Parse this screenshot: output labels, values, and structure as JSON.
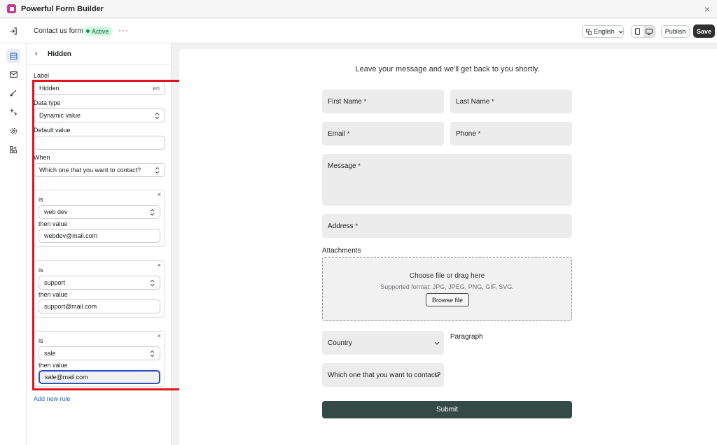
{
  "app": {
    "title": "Powerful Form Builder"
  },
  "topbar": {
    "form_name": "Contact us form",
    "status": "Active",
    "language": "English",
    "publish_label": "Publish",
    "save_label": "Save"
  },
  "panel": {
    "title": "Hidden",
    "label_caption": "Label",
    "label_value": "Hidden",
    "label_lang": "en",
    "data_type_caption": "Data type",
    "data_type_value": "Dynamic value",
    "default_caption": "Default value",
    "default_value": "",
    "when_caption": "When",
    "when_value": "Which one that you want to contact?",
    "rules": [
      {
        "is_label": "is",
        "is_value": "web dev",
        "then_label": "then value",
        "then_value": "webdev@mail.com"
      },
      {
        "is_label": "is",
        "is_value": "support",
        "then_label": "then value",
        "then_value": "support@mail.com"
      },
      {
        "is_label": "is",
        "is_value": "sale",
        "then_label": "then value",
        "then_value": "sale@mail.com"
      }
    ],
    "add_rule": "Add new rule"
  },
  "form": {
    "heading": "Leave your message and we'll get back to you shortly.",
    "first_name": "First Name",
    "last_name": "Last Name",
    "email": "Email",
    "phone": "Phone",
    "message": "Message",
    "address": "Address",
    "required_mark": "*",
    "attachments_label": "Attachments",
    "dropzone_title": "Choose file or drag here",
    "dropzone_sub": "Supported format: JPG, JPEG, PNG, GIF, SVG.",
    "browse_label": "Browse file",
    "country": "Country",
    "paragraph": "Paragraph",
    "contact_select": "Which one that you want to contact?",
    "submit_label": "Submit"
  },
  "colors": {
    "accent_highlight": "#e0141d",
    "submit_bg": "#334a45",
    "active_badge": "#cdfee1",
    "link": "#2463d0"
  }
}
